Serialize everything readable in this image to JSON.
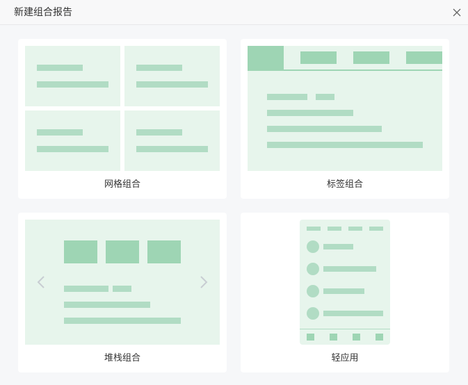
{
  "dialog": {
    "title": "新建组合报告",
    "close_icon": "close-icon"
  },
  "options": [
    {
      "id": "grid",
      "label": "网格组合"
    },
    {
      "id": "tabs",
      "label": "标签组合"
    },
    {
      "id": "stack",
      "label": "堆栈组合"
    },
    {
      "id": "light",
      "label": "轻应用"
    }
  ],
  "colors": {
    "page_bg": "#f6f7f9",
    "card_bg": "#ffffff",
    "pane_bg": "#e7f5ec",
    "line": "#b1dcc4",
    "accent_block": "#9ed5b4"
  }
}
